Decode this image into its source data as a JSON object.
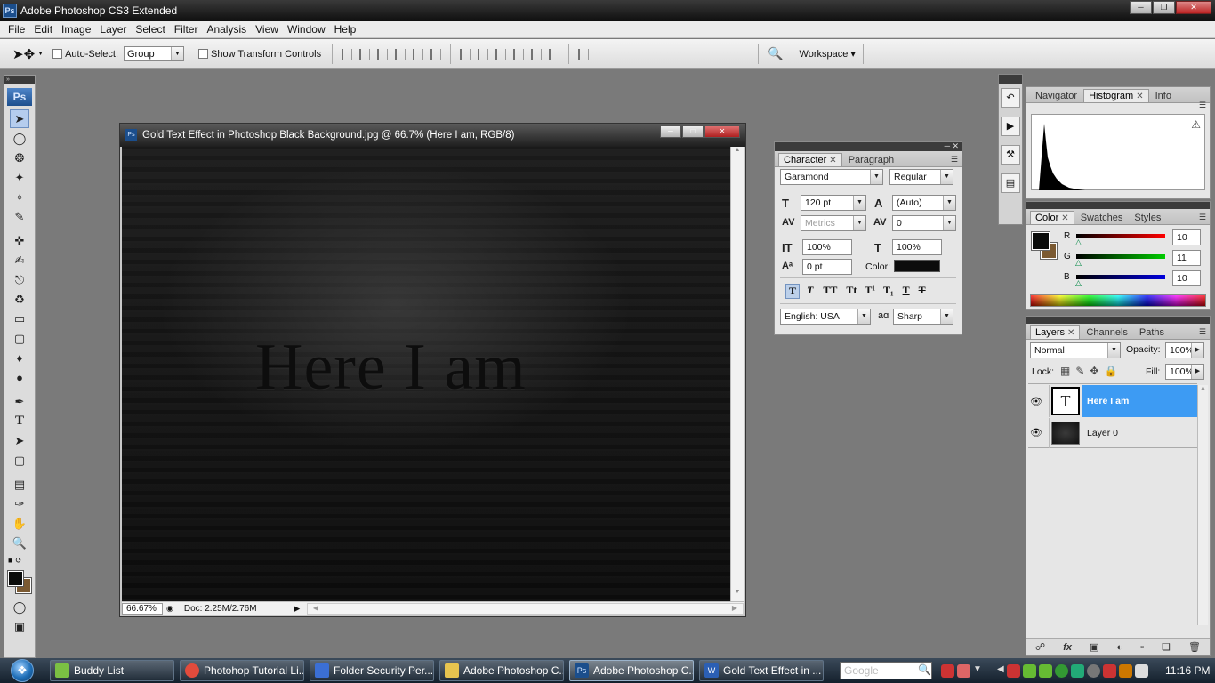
{
  "app": {
    "title": "Adobe Photoshop CS3 Extended",
    "ps_badge": "Ps"
  },
  "menu": [
    "File",
    "Edit",
    "Image",
    "Layer",
    "Select",
    "Filter",
    "Analysis",
    "View",
    "Window",
    "Help"
  ],
  "options": {
    "auto_select_label": "Auto-Select:",
    "auto_select_value": "Group",
    "show_transform_label": "Show Transform Controls",
    "workspace_label": "Workspace ▾"
  },
  "toolbox": {
    "logo": "Ps",
    "tools": [
      "move-tool-icon",
      "marquee-tool-icon",
      "lasso-tool-icon",
      "magic-wand-icon",
      "crop-tool-icon",
      "slice-tool-icon",
      "healing-brush-icon",
      "brush-tool-icon",
      "clone-stamp-icon",
      "history-brush-icon",
      "eraser-tool-icon",
      "gradient-tool-icon",
      "blur-tool-icon",
      "dodge-tool-icon",
      "pen-tool-icon",
      "type-tool-icon",
      "path-select-icon",
      "shape-tool-icon",
      "notes-tool-icon",
      "eyedropper-icon",
      "hand-tool-icon",
      "zoom-tool-icon"
    ],
    "colors": {
      "foreground": "#0a0b0a",
      "background": "#7b5a32"
    }
  },
  "document": {
    "title": "Gold Text Effect in Photoshop Black Background.jpg @ 66.7% (Here I am, RGB/8)",
    "canvas_text": "Here I am",
    "zoom": "66.67%",
    "doc_size": "Doc: 2.25M/2.76M"
  },
  "character": {
    "tabs": [
      "Character",
      "Paragraph"
    ],
    "font_family": "Garamond",
    "font_style": "Regular",
    "font_size": "120 pt",
    "leading": "(Auto)",
    "kerning": "Metrics",
    "tracking": "0",
    "vertical_scale": "100%",
    "horizontal_scale": "100%",
    "baseline_shift": "0 pt",
    "color_label": "Color:",
    "color": "#0c0c0c",
    "language": "English: USA",
    "aa_label": "aɑ",
    "antialias": "Sharp",
    "style_buttons": [
      "T",
      "T",
      "TT",
      "Tt",
      "T¹",
      "T₁",
      "T",
      "T"
    ]
  },
  "navigator": {
    "tabs": [
      "Navigator",
      "Histogram",
      "Info"
    ],
    "active": "Histogram"
  },
  "color_panel": {
    "tabs": [
      "Color",
      "Swatches",
      "Styles"
    ],
    "channels": [
      {
        "label": "R",
        "value": "10"
      },
      {
        "label": "G",
        "value": "11"
      },
      {
        "label": "B",
        "value": "10"
      }
    ],
    "foreground": "#0a0b0a",
    "background": "#7b5a32"
  },
  "layers": {
    "tabs": [
      "Layers",
      "Channels",
      "Paths"
    ],
    "blend_mode": "Normal",
    "opacity_label": "Opacity:",
    "opacity": "100%",
    "lock_label": "Lock:",
    "fill_label": "Fill:",
    "fill": "100%",
    "items": [
      {
        "name": "Here I am",
        "thumb": "T",
        "selected": true
      },
      {
        "name": "Layer 0",
        "thumb": "",
        "selected": false
      }
    ],
    "footer_icons": [
      "link-icon",
      "fx-icon",
      "mask-icon",
      "adjustment-icon",
      "group-icon",
      "new-layer-icon",
      "trash-icon"
    ]
  },
  "taskbar": {
    "items": [
      {
        "label": "Buddy List",
        "color": "#7bc043"
      },
      {
        "label": "Photohop Tutorial Li...",
        "color": "#e34b3c"
      },
      {
        "label": "Folder Security Per...",
        "color": "#3b6fd4"
      },
      {
        "label": "Adobe Photoshop C...",
        "color": "#e7c44f"
      },
      {
        "label": "Adobe Photoshop C...",
        "color": "#1b4e8c"
      },
      {
        "label": "Gold Text Effect in ...",
        "color": "#2b5fb4"
      }
    ],
    "search": "Google",
    "clock": "11:16 PM"
  }
}
